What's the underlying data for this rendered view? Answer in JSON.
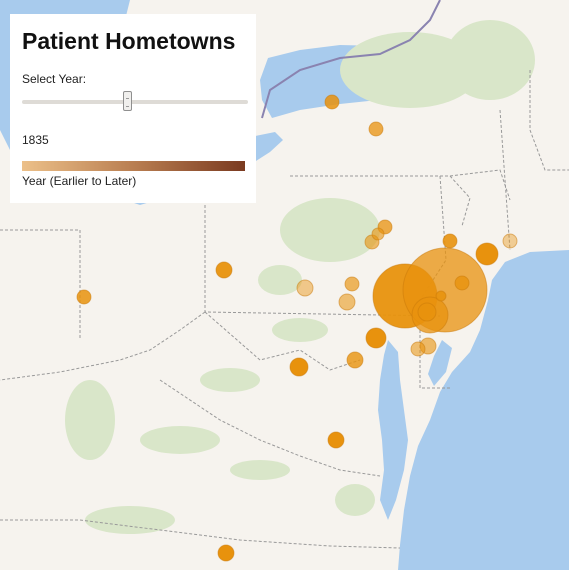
{
  "panel": {
    "title": "Patient Hometowns",
    "select_label": "Select Year:",
    "selected_year": "1835",
    "slider_level": 0.47,
    "legend_label": "Year (Earlier to Later)",
    "legend_colors": [
      "#ecc089",
      "#b97e51",
      "#7a3a20"
    ]
  },
  "colors": {
    "land": "#f6f3ee",
    "water": "#a8cbed",
    "forest": "#d9e6c9",
    "border": "#999999",
    "international_border": "#8a83b0",
    "marker": "#e8920d"
  }
}
